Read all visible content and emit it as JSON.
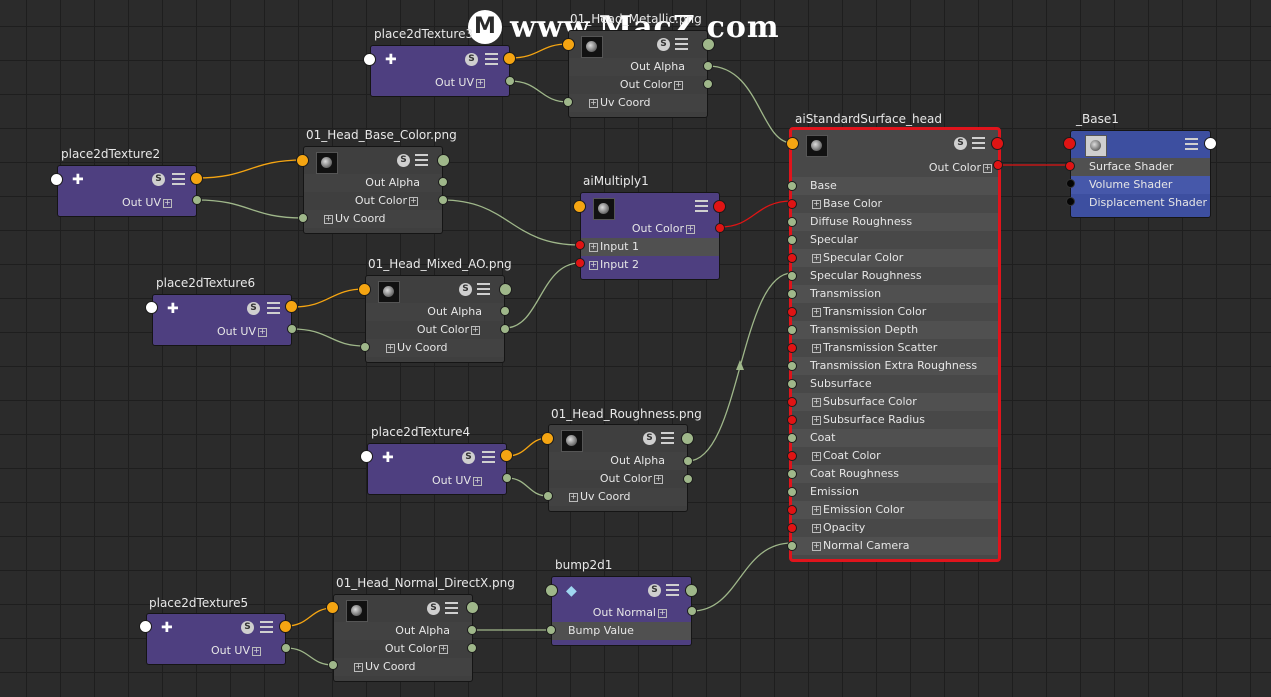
{
  "watermark": {
    "logo": "M",
    "text": "www.MacZ.com"
  },
  "nodes": {
    "place3": {
      "title": "place2dTexture3",
      "out_uv": "Out UV"
    },
    "place2": {
      "title": "place2dTexture2",
      "out_uv": "Out UV"
    },
    "place6": {
      "title": "place2dTexture6",
      "out_uv": "Out UV"
    },
    "place4": {
      "title": "place2dTexture4",
      "out_uv": "Out UV"
    },
    "place5": {
      "title": "place2dTexture5",
      "out_uv": "Out UV"
    },
    "tex_metallic": {
      "title": "01_Head_Metallic.png",
      "out_alpha": "Out Alpha",
      "out_color": "Out Color",
      "uv_coord": "Uv Coord"
    },
    "tex_base": {
      "title": "01_Head_Base_Color.png",
      "out_alpha": "Out Alpha",
      "out_color": "Out Color",
      "uv_coord": "Uv Coord"
    },
    "tex_ao": {
      "title": "01_Head_Mixed_AO.png",
      "out_alpha": "Out Alpha",
      "out_color": "Out Color",
      "uv_coord": "Uv Coord"
    },
    "tex_rough": {
      "title": "01_Head_Roughness.png",
      "out_alpha": "Out Alpha",
      "out_color": "Out Color",
      "uv_coord": "Uv Coord"
    },
    "tex_normal": {
      "title": "01_Head_Normal_DirectX.png",
      "out_alpha": "Out Alpha",
      "out_color": "Out Color",
      "uv_coord": "Uv Coord"
    },
    "mult": {
      "title": "aiMultiply1",
      "out_color": "Out Color",
      "input1": "Input 1",
      "input2": "Input 2"
    },
    "bump": {
      "title": "bump2d1",
      "out_normal": "Out Normal",
      "bump_value": "Bump Value"
    },
    "shader": {
      "title": "aiStandardSurface_head",
      "out_color": "Out Color",
      "attrs": [
        "Base",
        "Base Color",
        "Diffuse Roughness",
        "Specular",
        "Specular Color",
        "Specular Roughness",
        "Transmission",
        "Transmission Color",
        "Transmission Depth",
        "Transmission Scatter",
        "Transmission Extra Roughness",
        "Subsurface",
        "Subsurface Color",
        "Subsurface Radius",
        "Coat",
        "Coat Color",
        "Coat Roughness",
        "Emission",
        "Emission Color",
        "Opacity",
        "Normal Camera"
      ]
    },
    "sg": {
      "title": "_Base1",
      "surface": "Surface Shader",
      "volume": "Volume Shader",
      "displacement": "Displacement Shader"
    }
  },
  "icons": {
    "solo": "S",
    "menu": "menu-icon",
    "place2d": "place2d-icon",
    "thumbnail": "texture-thumbnail-icon"
  },
  "colors": {
    "canvas": "#2b2b2b",
    "place_node": "#4e3f80",
    "texture_node": "#3f3f3f",
    "shading_group": "#3d4fa0",
    "selection": "#e0141c",
    "wire": "#9fb78a",
    "uv_port": "#f5a512",
    "color_port": "#e01414"
  }
}
